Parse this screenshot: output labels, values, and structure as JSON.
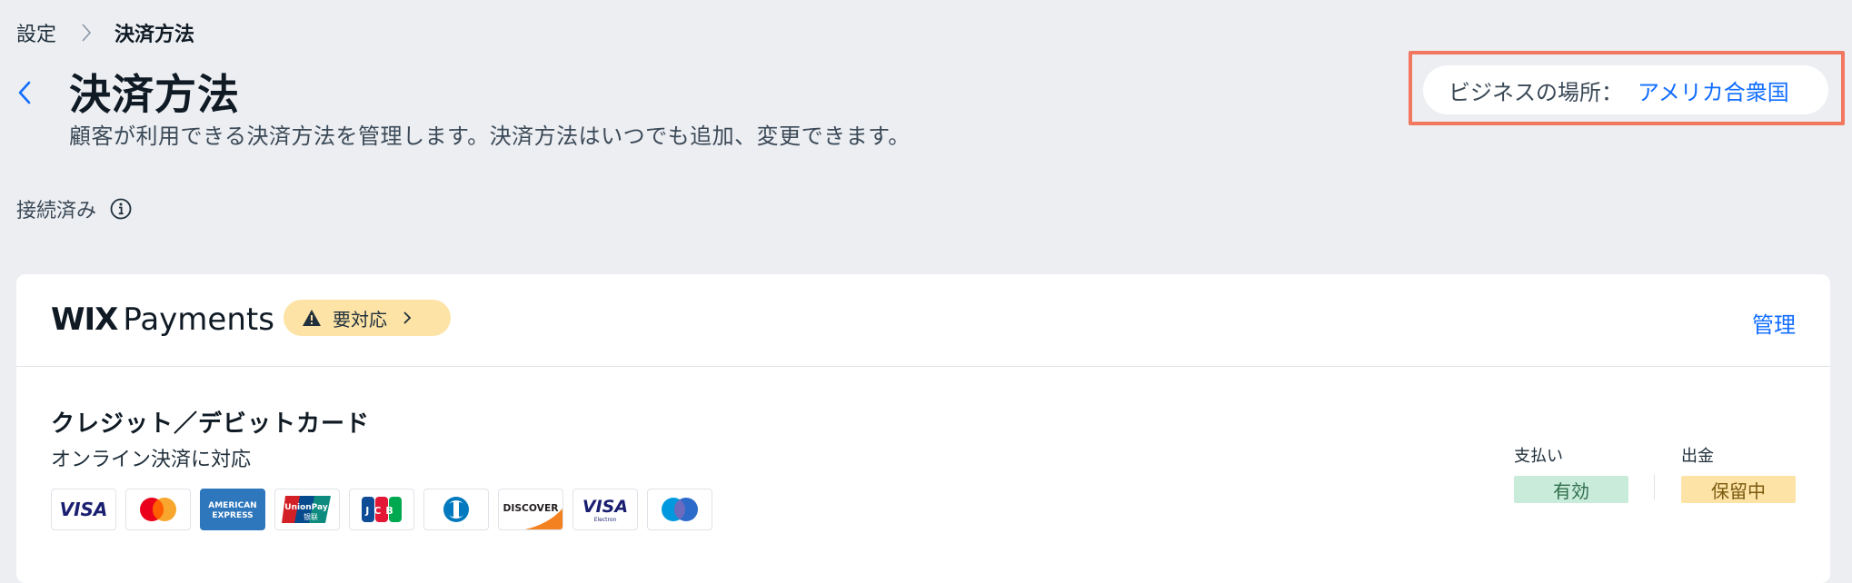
{
  "breadcrumb": {
    "parent": "設定",
    "current": "決済方法"
  },
  "page": {
    "title": "決済方法",
    "subtitle": "顧客が利用できる決済方法を管理します。決済方法はいつでも追加、変更できます。"
  },
  "location": {
    "label": "ビジネスの場所：",
    "value": "アメリカ合衆国"
  },
  "connected_label": "接続済み",
  "provider": {
    "brand_wix": "WIX",
    "brand_name": "Payments",
    "badge": "要対応",
    "manage": "管理"
  },
  "method": {
    "title": "クレジット／デビットカード",
    "subtitle": "オンライン決済に対応",
    "logos": [
      "visa",
      "mastercard",
      "amex",
      "unionpay",
      "jcb",
      "diners",
      "discover",
      "visa-electron",
      "maestro"
    ],
    "logo_text": {
      "visa": "VISA",
      "amex_1": "AMERICAN",
      "amex_2": "EXPRESS",
      "unionpay_1": "UnionPay",
      "unionpay_2": "银联",
      "jcb": "JCB",
      "discover": "DISCOVER",
      "visa_electron": "VISA",
      "electron": "Electron"
    }
  },
  "status": {
    "payment_label": "支払い",
    "payment_value": "有効",
    "payout_label": "出金",
    "payout_value": "保留中"
  },
  "colors": {
    "accent": "#116dff",
    "highlight_border": "#f2775f",
    "warning_bg": "#fde3a6",
    "success_bg": "#c9ebd9"
  }
}
